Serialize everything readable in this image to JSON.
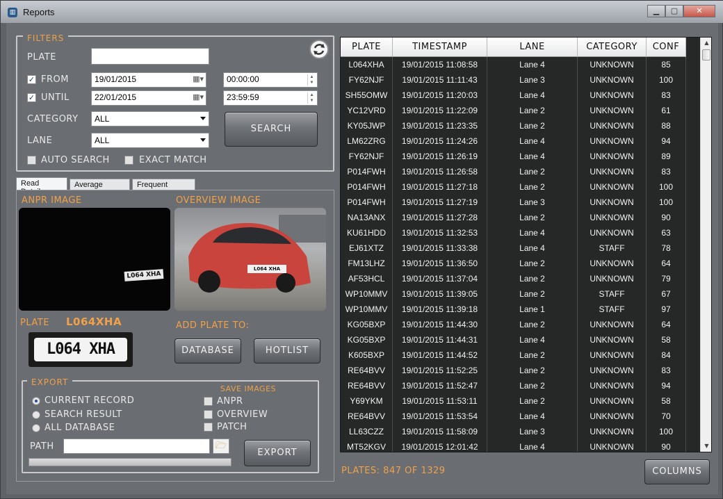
{
  "window": {
    "title": "Reports",
    "icon": "chart-icon"
  },
  "filters": {
    "group_title": "FILTERS",
    "plate_label": "PLATE",
    "plate_value": "",
    "from_label": "FROM",
    "from_checked": true,
    "from_date": "19/01/2015",
    "from_time": "00:00:00",
    "until_label": "UNTIL",
    "until_checked": true,
    "until_date": "22/01/2015",
    "until_time": "23:59:59",
    "category_label": "CATEGORY",
    "category_value": "ALL",
    "lane_label": "LANE",
    "lane_value": "ALL",
    "search_label": "SEARCH",
    "auto_search_label": "AUTO SEARCH",
    "exact_match_label": "EXACT MATCH",
    "refresh_icon": "refresh-icon"
  },
  "tabs": [
    "Read Details",
    "Average Hourly",
    "Frequent Visitors"
  ],
  "details": {
    "anpr_title": "ANPR IMAGE",
    "overview_title": "OVERVIEW IMAGE",
    "anpr_plate_text": "L064 XHA",
    "plate_label": "PLATE",
    "plate_value": "L064XHA",
    "patch_text": "L064 XHA",
    "add_plate_label": "ADD PLATE TO:",
    "database_label": "DATABASE",
    "hotlist_label": "HOTLIST",
    "overview_plate_text": "L064 XHA"
  },
  "export": {
    "group_title": "EXPORT",
    "current_record": "CURRENT RECORD",
    "search_result": "SEARCH RESULT",
    "all_database": "ALL DATABASE",
    "save_images_title": "SAVE IMAGES",
    "anpr": "ANPR",
    "overview": "OVERVIEW",
    "patch": "PATCH",
    "path_label": "PATH",
    "path_value": "",
    "export_label": "EXPORT"
  },
  "grid": {
    "columns": [
      "PLATE",
      "TIMESTAMP",
      "LANE",
      "CATEGORY",
      "CONF"
    ],
    "rows": [
      [
        "L064XHA",
        "19/01/2015 11:08:58",
        "Lane 4",
        "UNKNOWN",
        "85"
      ],
      [
        "FY62NJF",
        "19/01/2015 11:11:43",
        "Lane 3",
        "UNKNOWN",
        "100"
      ],
      [
        "SH55OMW",
        "19/01/2015 11:20:03",
        "Lane 4",
        "UNKNOWN",
        "83"
      ],
      [
        "YC12VRD",
        "19/01/2015 11:22:09",
        "Lane 2",
        "UNKNOWN",
        "61"
      ],
      [
        "KY05JWP",
        "19/01/2015 11:23:35",
        "Lane 2",
        "UNKNOWN",
        "88"
      ],
      [
        "LM62ZRG",
        "19/01/2015 11:24:26",
        "Lane 4",
        "UNKNOWN",
        "94"
      ],
      [
        "FY62NJF",
        "19/01/2015 11:26:19",
        "Lane 4",
        "UNKNOWN",
        "89"
      ],
      [
        "P014FWH",
        "19/01/2015 11:26:58",
        "Lane 2",
        "UNKNOWN",
        "83"
      ],
      [
        "P014FWH",
        "19/01/2015 11:27:18",
        "Lane 2",
        "UNKNOWN",
        "100"
      ],
      [
        "P014FWH",
        "19/01/2015 11:27:19",
        "Lane 3",
        "UNKNOWN",
        "100"
      ],
      [
        "NA13ANX",
        "19/01/2015 11:27:28",
        "Lane 2",
        "UNKNOWN",
        "90"
      ],
      [
        "KU61HDD",
        "19/01/2015 11:32:53",
        "Lane 4",
        "UNKNOWN",
        "63"
      ],
      [
        "EJ61XTZ",
        "19/01/2015 11:33:38",
        "Lane 4",
        "STAFF",
        "78"
      ],
      [
        "FM13LHZ",
        "19/01/2015 11:36:50",
        "Lane 2",
        "UNKNOWN",
        "64"
      ],
      [
        "AF53HCL",
        "19/01/2015 11:37:04",
        "Lane 2",
        "UNKNOWN",
        "79"
      ],
      [
        "WP10MMV",
        "19/01/2015 11:39:05",
        "Lane 2",
        "STAFF",
        "67"
      ],
      [
        "WP10MMV",
        "19/01/2015 11:39:18",
        "Lane 1",
        "STAFF",
        "97"
      ],
      [
        "KG05BXP",
        "19/01/2015 11:44:30",
        "Lane 2",
        "UNKNOWN",
        "64"
      ],
      [
        "KG05BXP",
        "19/01/2015 11:44:31",
        "Lane 4",
        "UNKNOWN",
        "58"
      ],
      [
        "K605BXP",
        "19/01/2015 11:44:52",
        "Lane 2",
        "UNKNOWN",
        "84"
      ],
      [
        "RE64BVV",
        "19/01/2015 11:52:25",
        "Lane 2",
        "UNKNOWN",
        "83"
      ],
      [
        "RE64BVV",
        "19/01/2015 11:52:47",
        "Lane 2",
        "UNKNOWN",
        "94"
      ],
      [
        "Y69YKM",
        "19/01/2015 11:53:11",
        "Lane 2",
        "UNKNOWN",
        "58"
      ],
      [
        "RE64BVV",
        "19/01/2015 11:53:54",
        "Lane 4",
        "UNKNOWN",
        "70"
      ],
      [
        "LL63CZZ",
        "19/01/2015 11:58:09",
        "Lane 3",
        "UNKNOWN",
        "100"
      ],
      [
        "MT52KGV",
        "19/01/2015 12:01:42",
        "Lane 4",
        "UNKNOWN",
        "90"
      ]
    ]
  },
  "footer": {
    "plates_count": "PLATES: 847 OF 1329",
    "columns_label": "COLUMNS"
  },
  "colors": {
    "accent": "#f0a14a",
    "grid_bg": "#262727"
  }
}
